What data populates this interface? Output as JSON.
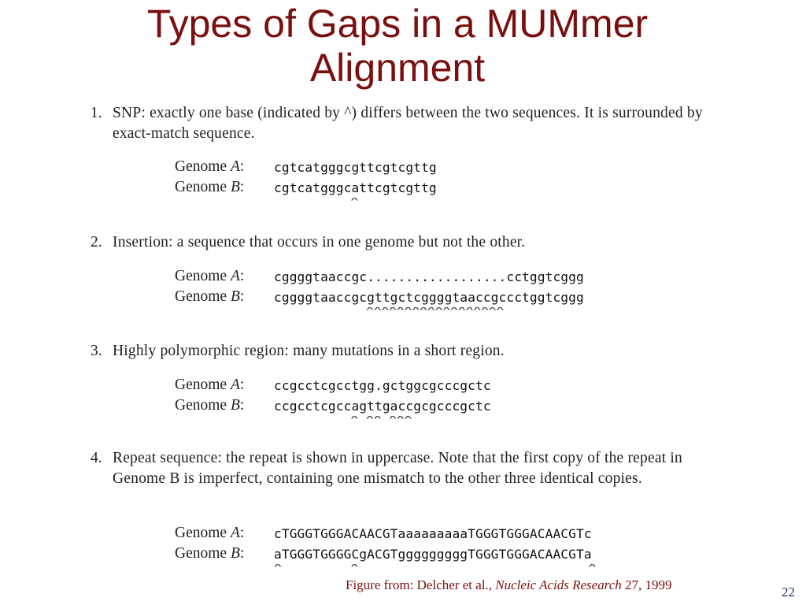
{
  "slide": {
    "title_line1": "Types of Gaps in a MUMmer",
    "title_line2": "Alignment",
    "page_number": "22",
    "colors": {
      "title": "#7a0f0f",
      "footer": "#7a0f0f",
      "page_number": "#1f2f6b"
    }
  },
  "items": [
    {
      "number": "1.",
      "description": "SNP: exactly one base (indicated by ^) differs between the two sequences.  It is surrounded by exact-match sequence.",
      "genome_a_label": "Genome A:",
      "genome_a_seq": "cgtcatgggcgttcgtcgttg",
      "genome_b_label": "Genome B:",
      "genome_b_seq": "cgtcatgggcattcgtcgttg",
      "markers": "          ^"
    },
    {
      "number": "2.",
      "description": "Insertion: a sequence that occurs in one genome but not the other.",
      "genome_a_label": "Genome A:",
      "genome_a_seq": "cggggtaaccgc..................cctggtcggg",
      "genome_b_label": "Genome B:",
      "genome_b_seq": "cggggtaaccgcgttgctcggggtaaccgccctggtcggg",
      "markers": "            ^^^^^^^^^^^^^^^^^^"
    },
    {
      "number": "3.",
      "description": "Highly polymorphic region: many mutations in a short region.",
      "genome_a_label": "Genome A:",
      "genome_a_seq": "ccgcctcgcctgg.gctggcgcccgctc",
      "genome_b_label": "Genome B:",
      "genome_b_seq": "ccgcctcgccagttgaccgcgcccgctc",
      "markers": "          ^ ^^ ^^^"
    },
    {
      "number": "4.",
      "description": "Repeat sequence:  the repeat is shown in uppercase.  Note that the first copy of the repeat in Genome B is imperfect, containing one mismatch to the other three identical copies.",
      "genome_a_label": "Genome A:",
      "genome_a_seq": "cTGGGTGGGACAACGTaaaaaaaaaTGGGTGGGACAACGTc",
      "genome_b_label": "Genome B:",
      "genome_b_seq": "aTGGGTGGGGCgACGTgggggggggTGGGTGGGACAACGTa",
      "markers": "^         ^                              ^"
    }
  ],
  "footer": {
    "prefix": "Figure from: Delcher et al.,  ",
    "journal": "Nucleic Acids Research",
    "suffix": " 27, 1999"
  }
}
